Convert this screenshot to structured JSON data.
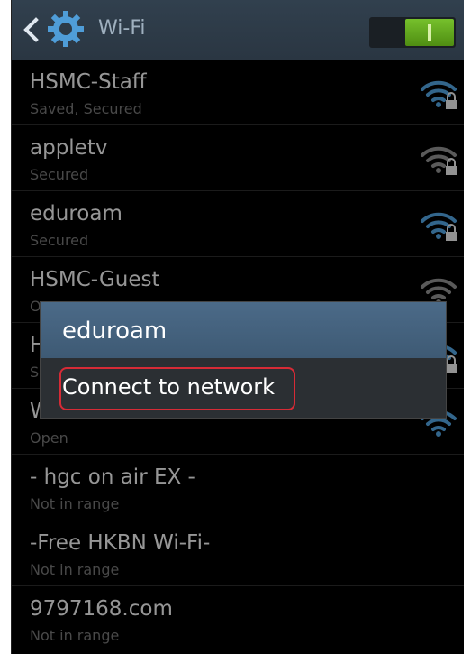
{
  "action_bar": {
    "title": "Wi-Fi",
    "toggle_on": true,
    "colors": {
      "accent": "#4f9dd8",
      "toggle_green": "#5aa018"
    }
  },
  "networks": [
    {
      "name": "HSMC-Staff",
      "status": "Saved, Secured",
      "signal_color": "#4f9dd8",
      "locked": true
    },
    {
      "name": "appletv",
      "status": "Secured",
      "signal_color": "#8a8a8a",
      "locked": true
    },
    {
      "name": "eduroam",
      "status": "Secured",
      "signal_color": "#4f9dd8",
      "locked": true
    },
    {
      "name": "HSMC-Guest",
      "status": "O",
      "signal_color": "#8a8a8a",
      "locked": false
    },
    {
      "name": "H",
      "status": "S",
      "signal_color": "#4f9dd8",
      "locked": true
    },
    {
      "name": "Wi-Fi.hk via HSMC",
      "status": "Open",
      "signal_color": "#4f9dd8",
      "locked": false
    },
    {
      "name": "- hgc on air EX -",
      "status": "Not in range"
    },
    {
      "name": "-Free HKBN Wi-Fi-",
      "status": "Not in range"
    },
    {
      "name": "9797168.com",
      "status": "Not in range"
    }
  ],
  "dialog": {
    "title": "eduroam",
    "option": "Connect to network",
    "highlight_color": "#d62b36"
  }
}
